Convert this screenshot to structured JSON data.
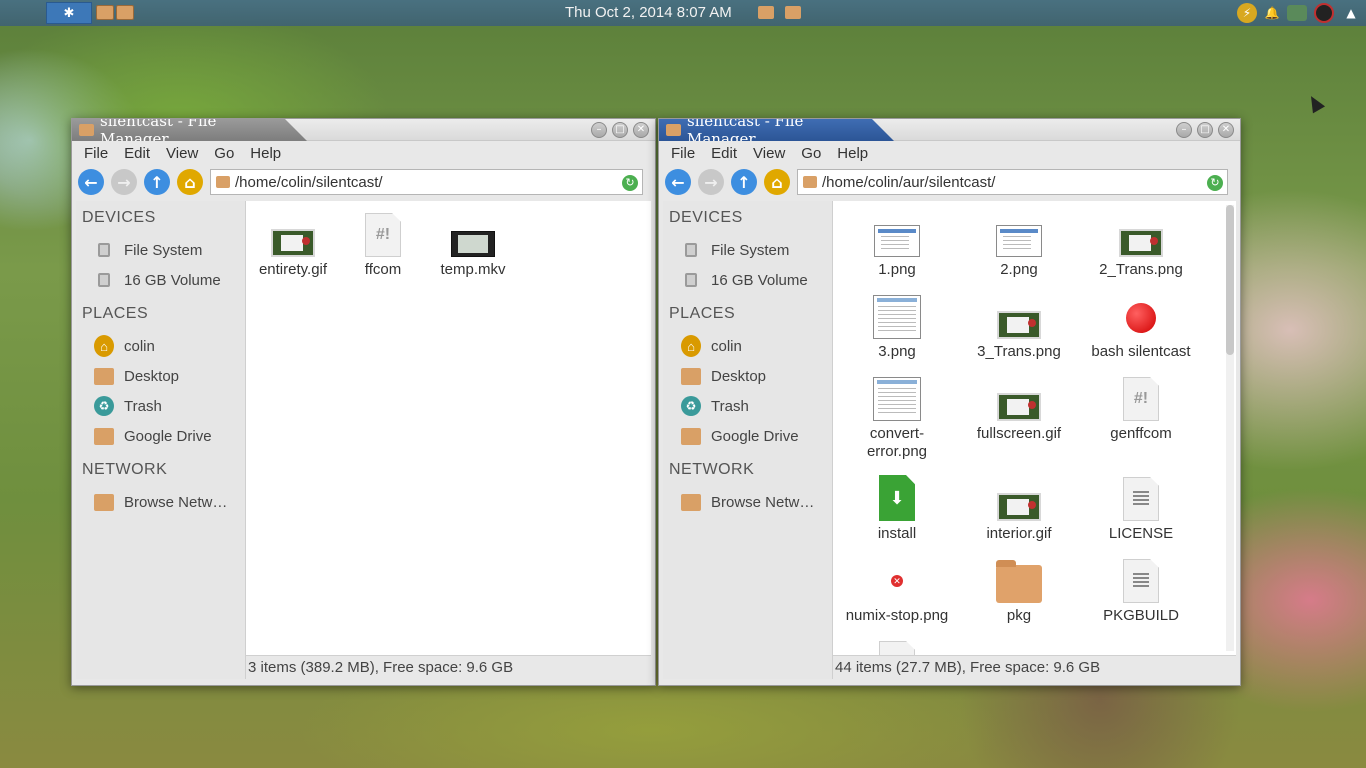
{
  "panel": {
    "clock": "Thu Oct 2, 2014   8:07 AM"
  },
  "windows": [
    {
      "title": "silentcast - File Manager",
      "menu": [
        "File",
        "Edit",
        "View",
        "Go",
        "Help"
      ],
      "location": "/home/colin/silentcast/",
      "sidebar": {
        "devices_heading": "DEVICES",
        "devices": [
          "File System",
          "16 GB Volume"
        ],
        "places_heading": "PLACES",
        "places": [
          "colin",
          "Desktop",
          "Trash",
          "Google Drive"
        ],
        "network_heading": "NETWORK",
        "network": [
          "Browse Netw…"
        ]
      },
      "files": [
        "entirety.gif",
        "ffcom",
        "temp.mkv"
      ],
      "status": "3 items (389.2 MB), Free space: 9.6 GB"
    },
    {
      "title": "silentcast - File Manager",
      "menu": [
        "File",
        "Edit",
        "View",
        "Go",
        "Help"
      ],
      "location": "/home/colin/aur/silentcast/",
      "sidebar": {
        "devices_heading": "DEVICES",
        "devices": [
          "File System",
          "16 GB Volume"
        ],
        "places_heading": "PLACES",
        "places": [
          "colin",
          "Desktop",
          "Trash",
          "Google Drive"
        ],
        "network_heading": "NETWORK",
        "network": [
          "Browse Netw…"
        ]
      },
      "files": [
        "1.png",
        "2.png",
        "2_Trans.png",
        "3.png",
        "3_Trans.png",
        "bash silentcast",
        "convert-",
        "error.png",
        "fullscreen.gif",
        "genffcom",
        "install",
        "interior.gif",
        "LICENSE",
        "numix-stop.png",
        "pkg",
        "PKGBUILD"
      ],
      "status": "44 items (27.7 MB), Free space: 9.6 GB"
    }
  ]
}
